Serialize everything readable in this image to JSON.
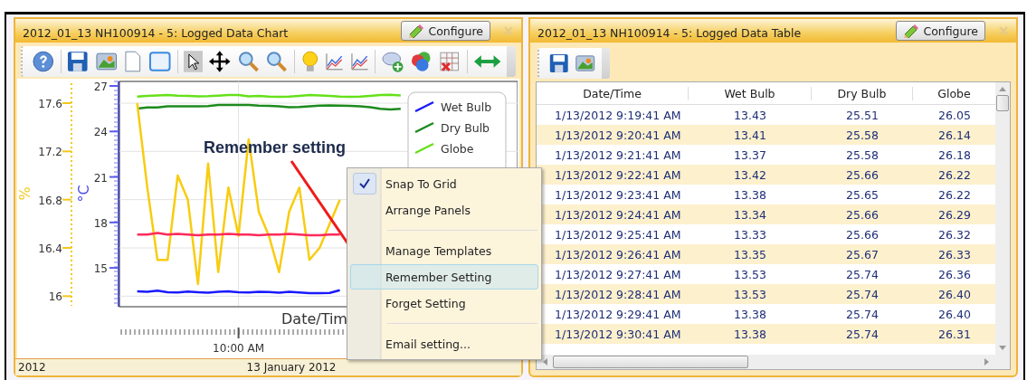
{
  "chart_panel": {
    "title": "2012_01_13 NH100914 - 5: Logged Data Chart",
    "configure_button": "Configure",
    "chart_data": {
      "type": "line",
      "xlabel": "Date/Tim",
      "ylabel": "°C",
      "y2label": "%",
      "ylim": [
        12.5,
        27.3
      ],
      "y2lim": [
        15.92,
        17.78
      ],
      "grid": true,
      "legend": "upper right",
      "yticks": [
        {
          "value": 27,
          "label": "27"
        },
        {
          "value": 24,
          "label": "24"
        },
        {
          "value": 21,
          "label": "21"
        },
        {
          "value": 18,
          "label": "18"
        },
        {
          "value": 15,
          "label": "15"
        }
      ],
      "y2ticks": [
        {
          "value": 17.6,
          "label": "17.6"
        },
        {
          "value": 17.2,
          "label": "17.2"
        },
        {
          "value": 16.8,
          "label": "16.8"
        },
        {
          "value": 16.4,
          "label": "16.4"
        },
        {
          "value": 16,
          "label": "16"
        }
      ],
      "series": [
        {
          "name": "Wet Bulb",
          "color": "#1a1aff",
          "values": [
            13.45,
            13.42,
            13.5,
            13.4,
            13.38,
            13.44,
            13.4,
            13.36,
            13.42,
            13.45,
            13.4,
            13.38,
            13.43,
            13.41,
            13.37,
            13.42,
            13.38,
            13.34,
            13.33,
            13.35,
            13.53,
            null,
            null,
            null,
            null,
            null,
            null,
            null,
            null,
            null,
            null,
            null,
            null,
            null,
            null
          ]
        },
        {
          "name": "Dry Bulb",
          "color": "#1e8a1e",
          "values": [
            25.51,
            25.58,
            25.58,
            25.66,
            25.65,
            25.66,
            25.66,
            25.67,
            25.74,
            25.74,
            25.74,
            25.74,
            25.7,
            25.68,
            25.65,
            25.6,
            25.62,
            25.66,
            25.7,
            25.72,
            25.7,
            25.68,
            25.66,
            25.6,
            25.5,
            25.45,
            25.5,
            null,
            null,
            null,
            null,
            null,
            null,
            null,
            null
          ]
        },
        {
          "name": "Globe",
          "color": "#66e01a",
          "values": [
            26.3,
            26.34,
            26.38,
            26.4,
            26.36,
            26.35,
            26.32,
            26.33,
            26.36,
            26.4,
            26.4,
            26.31,
            26.35,
            26.3,
            26.28,
            26.3,
            26.35,
            26.4,
            26.38,
            26.34,
            26.3,
            26.28,
            26.3,
            26.35,
            26.4,
            26.42,
            26.38,
            null,
            null,
            null,
            null,
            null,
            null,
            null,
            null
          ]
        },
        {
          "color": "#f8cc10",
          "axis": "y2",
          "values": [
            17.6,
            16.9,
            16.3,
            16.3,
            17.0,
            16.8,
            16.1,
            17.1,
            16.2,
            16.9,
            16.5,
            17.3,
            16.7,
            16.5,
            16.2,
            16.7,
            16.9,
            16.3,
            16.4,
            16.6,
            16.8,
            null,
            null,
            null,
            null,
            null,
            null,
            null,
            null,
            null,
            null,
            null,
            null,
            null,
            null
          ]
        },
        {
          "color": "#ff2a5a",
          "values": [
            17.2,
            17.2,
            17.3,
            17.2,
            17.25,
            17.2,
            17.15,
            17.2,
            17.2,
            17.25,
            17.2,
            17.2,
            17.15,
            17.2,
            17.2,
            17.25,
            17.2,
            17.15,
            17.15,
            17.2,
            17.2,
            null,
            null,
            null,
            null,
            null,
            null,
            null,
            null,
            null,
            null,
            null,
            null,
            null,
            null
          ]
        }
      ]
    },
    "time_label": "10:00 AM",
    "status_bar": {
      "year": "2012",
      "date": "13 January 2012"
    }
  },
  "annotation": {
    "text": "Remember setting"
  },
  "context_menu": [
    {
      "kind": "item",
      "label": "Snap To Grid",
      "checked": true,
      "selected": false
    },
    {
      "kind": "item",
      "label": "Arrange Panels",
      "checked": false,
      "selected": false
    },
    {
      "kind": "separator"
    },
    {
      "kind": "item",
      "label": "Manage Templates",
      "checked": false,
      "selected": false
    },
    {
      "kind": "item",
      "label": "Remember Setting",
      "checked": false,
      "selected": true
    },
    {
      "kind": "item",
      "label": "Forget Setting",
      "checked": false,
      "selected": false
    },
    {
      "kind": "separator"
    },
    {
      "kind": "item",
      "label": "Email setting...",
      "checked": false,
      "selected": false
    }
  ],
  "table_panel": {
    "title": "2012_01_13 NH100914 - 5: Logged Data Table",
    "configure_button": "Configure",
    "columns": [
      "Date/Time",
      "Wet Bulb",
      "Dry Bulb",
      "Globe"
    ],
    "rows": [
      [
        "1/13/2012 9:19:41 AM",
        "13.43",
        "25.51",
        "26.05"
      ],
      [
        "1/13/2012 9:20:41 AM",
        "13.41",
        "25.58",
        "26.14"
      ],
      [
        "1/13/2012 9:21:41 AM",
        "13.37",
        "25.58",
        "26.18"
      ],
      [
        "1/13/2012 9:22:41 AM",
        "13.42",
        "25.66",
        "26.22"
      ],
      [
        "1/13/2012 9:23:41 AM",
        "13.38",
        "25.65",
        "26.22"
      ],
      [
        "1/13/2012 9:24:41 AM",
        "13.34",
        "25.66",
        "26.29"
      ],
      [
        "1/13/2012 9:25:41 AM",
        "13.33",
        "25.66",
        "26.32"
      ],
      [
        "1/13/2012 9:26:41 AM",
        "13.35",
        "25.67",
        "26.33"
      ],
      [
        "1/13/2012 9:27:41 AM",
        "13.53",
        "25.74",
        "26.36"
      ],
      [
        "1/13/2012 9:28:41 AM",
        "13.53",
        "25.74",
        "26.40"
      ],
      [
        "1/13/2012 9:29:41 AM",
        "13.38",
        "25.74",
        "26.40"
      ],
      [
        "1/13/2012 9:30:41 AM",
        "13.38",
        "25.74",
        "26.31"
      ]
    ]
  }
}
